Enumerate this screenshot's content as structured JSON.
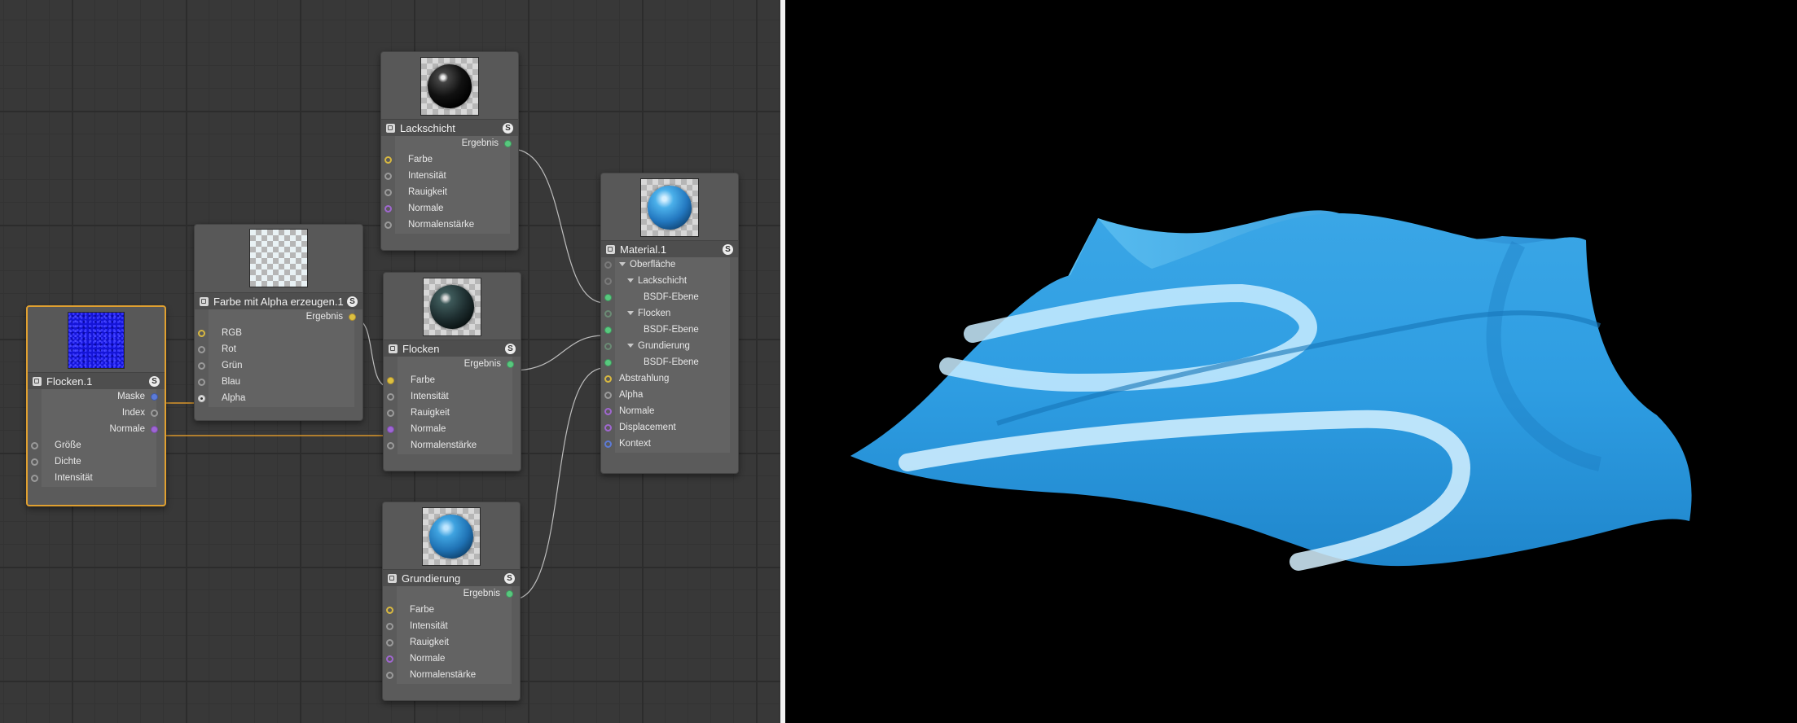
{
  "nodes": {
    "flocken1": {
      "title": "Flocken.1",
      "solo": "S",
      "outputs": [
        "Maske",
        "Index",
        "Normale"
      ],
      "inputs": [
        "Größe",
        "Dichte",
        "Intensität"
      ]
    },
    "farbe_alpha": {
      "title": "Farbe mit Alpha erzeugen.1",
      "solo": "S",
      "output": "Ergebnis",
      "inputs": [
        "RGB",
        "Rot",
        "Grün",
        "Blau",
        "Alpha"
      ]
    },
    "lackschicht": {
      "title": "Lackschicht",
      "solo": "S",
      "output": "Ergebnis",
      "inputs": [
        "Farbe",
        "Intensität",
        "Rauigkeit",
        "Normale",
        "Normalenstärke"
      ]
    },
    "flocken": {
      "title": "Flocken",
      "solo": "S",
      "output": "Ergebnis",
      "inputs": [
        "Farbe",
        "Intensität",
        "Rauigkeit",
        "Normale",
        "Normalenstärke"
      ]
    },
    "grundierung": {
      "title": "Grundierung",
      "solo": "S",
      "output": "Ergebnis",
      "inputs": [
        "Farbe",
        "Intensität",
        "Rauigkeit",
        "Normale",
        "Normalenstärke"
      ]
    },
    "material1": {
      "title": "Material.1",
      "solo": "S",
      "tree": [
        "Oberfläche",
        "Lackschicht",
        "BSDF-Ebene",
        "Flocken",
        "BSDF-Ebene",
        "Grundierung",
        "BSDF-Ebene"
      ],
      "inputs": [
        "Abstrahlung",
        "Alpha",
        "Normale",
        "Displacement",
        "Kontext"
      ]
    }
  },
  "colors": {
    "wire": "#bdbdbd",
    "wire_selected": "#d9962a",
    "selection": "#e0a030",
    "surface_blue": "#2fa8ec"
  }
}
